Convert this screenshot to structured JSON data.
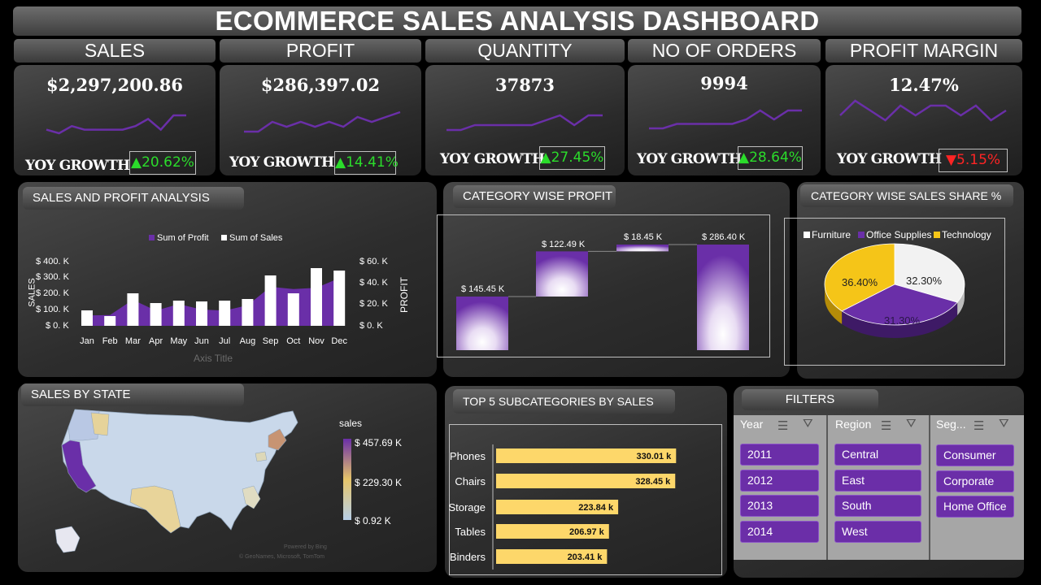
{
  "title": "ECOMMERCE SALES ANALYSIS DASHBOARD",
  "kpis": [
    {
      "label": "SALES",
      "value": "$2,297,200.86",
      "yoy_label": "YOY GROWTH",
      "yoy": "▲20.62%",
      "direction": "up"
    },
    {
      "label": "PROFIT",
      "value": "$286,397.02",
      "yoy_label": "YOY GROWTH",
      "yoy": "▲14.41%",
      "direction": "up"
    },
    {
      "label": "QUANTITY",
      "value": "37873",
      "yoy_label": "YOY GROWTH",
      "yoy": "▲27.45%",
      "direction": "up"
    },
    {
      "label": "NO OF ORDERS",
      "value": "9994",
      "yoy_label": "YOY GROWTH",
      "yoy": "▲28.64%",
      "direction": "up"
    },
    {
      "label": "PROFIT MARGIN",
      "value": "12.47%",
      "yoy_label": "YOY GROWTH",
      "yoy": "▼5.15%",
      "direction": "down"
    }
  ],
  "sales_profit": {
    "title": "SALES AND PROFIT ANALYSIS",
    "legend_profit": "Sum of Profit",
    "legend_sales": "Sum of Sales",
    "axis_title": "Axis Title",
    "y_left_label": "SALES",
    "y_right_label": "PROFIT",
    "y_left_ticks": [
      "$ 400. K",
      "$ 300. K",
      "$ 200. K",
      "$ 100. K",
      "$ 0. K"
    ],
    "y_right_ticks": [
      "$ 60. K",
      "$ 40. K",
      "$ 20. K",
      "$ 0. K"
    ]
  },
  "category_profit": {
    "title": "CATEGORY WISE PROFIT",
    "labels": [
      "$ 145.45 K",
      "$ 122.49 K",
      "$ 18.45 K",
      "$ 286.40 K"
    ]
  },
  "category_share": {
    "title": "CATEGORY WISE SALES SHARE %",
    "legend": [
      "Furniture",
      "Office Supplies",
      "Technology"
    ],
    "labels": [
      "32.30%",
      "31.30%",
      "36.40%"
    ]
  },
  "sales_by_state": {
    "title": "SALES BY STATE",
    "legend_title": "sales",
    "legend_ticks": [
      "$ 457.69 K",
      "$ 229.30 K",
      "$ 0.92 K"
    ],
    "powered": "Powered by Bing",
    "credit": "© GeoNames, Microsoft, TomTom"
  },
  "top_subcategories": {
    "title": "TOP 5 SUBCATEGORIES BY SALES"
  },
  "filters": {
    "title": "FILTERS",
    "columns": [
      {
        "title": "Year",
        "items": [
          "2011",
          "2012",
          "2013",
          "2014"
        ]
      },
      {
        "title": "Region",
        "items": [
          "Central",
          "East",
          "South",
          "West"
        ]
      },
      {
        "title": "Seg...",
        "items": [
          "Consumer",
          "Corporate",
          "Home Office"
        ]
      }
    ]
  },
  "colors": {
    "purple": "#6a2fa8",
    "gold": "#f5c518",
    "green": "#2bdc2b",
    "red": "#ff2424",
    "bar_yellow": "#fdd76a"
  },
  "chart_data": [
    {
      "type": "bar",
      "title": "SALES AND PROFIT ANALYSIS",
      "categories": [
        "Jan",
        "Feb",
        "Mar",
        "Apr",
        "May",
        "Jun",
        "Jul",
        "Aug",
        "Sep",
        "Oct",
        "Nov",
        "Dec"
      ],
      "series": [
        {
          "name": "Sum of Sales",
          "values": [
            95,
            60,
            200,
            140,
            155,
            150,
            155,
            165,
            310,
            200,
            355,
            340
          ]
        },
        {
          "name": "Sum of Profit",
          "values": [
            9.5,
            10,
            24,
            14,
            20,
            15,
            14,
            19,
            36,
            34,
            35,
            44
          ]
        }
      ],
      "ylabel": "SALES",
      "y2label": "PROFIT",
      "xlabel": "Axis Title",
      "ylim": [
        0,
        400
      ],
      "y2lim": [
        0,
        60
      ],
      "legend": "top"
    },
    {
      "type": "bar",
      "title": "CATEGORY WISE PROFIT",
      "categories": [
        "",
        "",
        "",
        ""
      ],
      "values": [
        145.45,
        122.49,
        18.45,
        286.4
      ]
    },
    {
      "type": "pie",
      "title": "CATEGORY WISE SALES SHARE %",
      "categories": [
        "Furniture",
        "Office Supplies",
        "Technology"
      ],
      "values": [
        32.3,
        31.3,
        36.4
      ],
      "legend": "top"
    },
    {
      "type": "bar",
      "title": "TOP 5 SUBCATEGORIES BY SALES",
      "categories": [
        "Phones",
        "Chairs",
        "Storage",
        "Tables",
        "Binders"
      ],
      "values": [
        330.01,
        328.45,
        223.84,
        206.97,
        203.41
      ],
      "value_labels": [
        "330.01 k",
        "328.45 k",
        "223.84 k",
        "206.97 k",
        "203.41 k"
      ]
    },
    {
      "type": "line",
      "title": "SALES",
      "values": [
        3,
        2,
        4,
        3,
        3,
        3,
        3,
        4,
        6,
        3,
        7,
        7
      ]
    },
    {
      "type": "line",
      "title": "PROFIT",
      "values": [
        2,
        2,
        4,
        3,
        4,
        3,
        4,
        3,
        5,
        4,
        5,
        6
      ]
    },
    {
      "type": "line",
      "title": "QUANTITY",
      "values": [
        2,
        2,
        3,
        3,
        3,
        3,
        3,
        4,
        5,
        3,
        5,
        5
      ]
    },
    {
      "type": "line",
      "title": "NO OF ORDERS",
      "values": [
        2,
        2,
        3,
        3,
        3,
        3,
        3,
        4,
        6,
        4,
        6,
        6
      ]
    },
    {
      "type": "line",
      "title": "PROFIT MARGIN",
      "values": [
        4,
        7,
        5,
        3,
        6,
        4,
        6,
        6,
        4,
        6,
        3,
        5
      ]
    }
  ]
}
